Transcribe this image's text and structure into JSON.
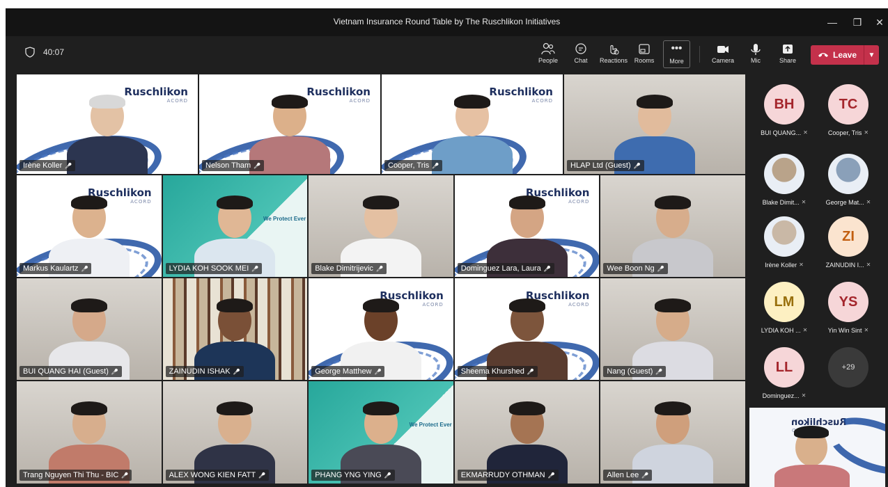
{
  "window": {
    "title": "Vietnam Insurance Round Table by The Ruschlikon Initiatives",
    "minimize_icon": "minimize-icon",
    "restore_icon": "restore-icon",
    "close_icon": "close-icon"
  },
  "toolbar": {
    "timer": "40:07",
    "buttons": [
      {
        "label": "People",
        "icon": "people-icon"
      },
      {
        "label": "Chat",
        "icon": "chat-icon"
      },
      {
        "label": "Reactions",
        "icon": "reactions-icon"
      },
      {
        "label": "Rooms",
        "icon": "rooms-icon"
      },
      {
        "label": "More",
        "icon": "more-icon"
      },
      {
        "label": "Camera",
        "icon": "camera-icon"
      },
      {
        "label": "Mic",
        "icon": "mic-icon"
      },
      {
        "label": "Share",
        "icon": "share-icon"
      }
    ],
    "leave_label": "Leave"
  },
  "brand": {
    "name": "Ruschlikon",
    "sub": "ACORD",
    "protect": "We Protect Ever"
  },
  "tiles": [
    {
      "name": "Irène Koller"
    },
    {
      "name": "Nelson Tham"
    },
    {
      "name": "Cooper, Tris"
    },
    {
      "name": "HLAP Ltd (Guest)"
    },
    {
      "name": "Markus Kaulartz"
    },
    {
      "name": "LYDIA KOH SOOK MEI"
    },
    {
      "name": "Blake Dimitrijevic"
    },
    {
      "name": "Dominguez Lara, Laura"
    },
    {
      "name": "Wee Boon Ng"
    },
    {
      "name": "BUI QUANG HAI (Guest)"
    },
    {
      "name": "ZAINUDIN ISHAK"
    },
    {
      "name": "George Matthew"
    },
    {
      "name": "Sheema Khurshed"
    },
    {
      "name": "Nang (Guest)"
    },
    {
      "name": "Trang Nguyen Thi Thu - BIC"
    },
    {
      "name": "ALEX WONG KIEN FATT"
    },
    {
      "name": "PHANG YNG YING"
    },
    {
      "name": "EKMARRUDY OTHMAN"
    },
    {
      "name": "Allen Lee"
    }
  ],
  "sidebar": {
    "participants": [
      {
        "initials": "BH",
        "name": "BUI QUANG...",
        "bg": "#f6d6d8",
        "fg": "#a4262c"
      },
      {
        "initials": "TC",
        "name": "Cooper, Tris",
        "bg": "#f6d6d8",
        "fg": "#a4262c"
      },
      {
        "initials": "",
        "name": "Blake Dimit...",
        "bg": "#b9a38a",
        "fg": "#fff"
      },
      {
        "initials": "",
        "name": "George Mat...",
        "bg": "#8aa0b9",
        "fg": "#fff"
      },
      {
        "initials": "",
        "name": "Irène Koller",
        "bg": "#c9b8a6",
        "fg": "#fff"
      },
      {
        "initials": "ZI",
        "name": "ZAINUDIN I...",
        "bg": "#fbe4cf",
        "fg": "#c25e0f"
      },
      {
        "initials": "LM",
        "name": "LYDIA KOH ...",
        "bg": "#fdf0c2",
        "fg": "#986f0b"
      },
      {
        "initials": "YS",
        "name": "Yin Win Sint",
        "bg": "#f6d6d8",
        "fg": "#a4262c"
      },
      {
        "initials": "LL",
        "name": "Dominguez...",
        "bg": "#f6d6d8",
        "fg": "#a4262c"
      }
    ],
    "overflow": "+29"
  },
  "colors": {
    "leave": "#c4314b",
    "background": "#1f1f1f"
  }
}
